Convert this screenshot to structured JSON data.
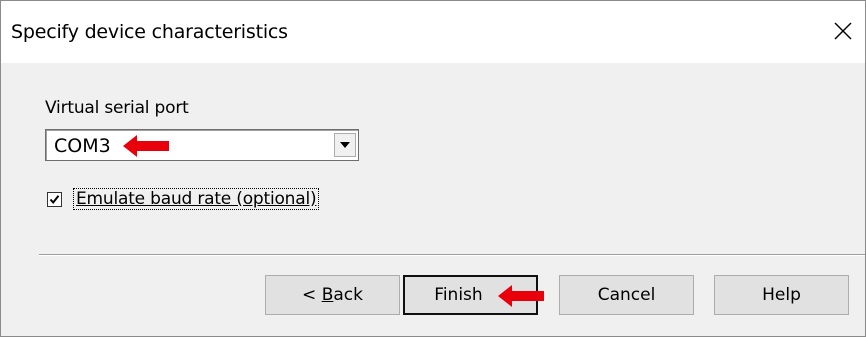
{
  "window": {
    "title": "Specify device characteristics",
    "close_glyph": "✕"
  },
  "port": {
    "label": "Virtual serial port",
    "selected": "COM3"
  },
  "baud": {
    "label": "Emulate baud rate (optional)",
    "checked": true
  },
  "buttons": {
    "back_prefix": "< ",
    "back_mnemonic": "B",
    "back_rest": "ack",
    "finish": "Finish",
    "cancel": "Cancel",
    "help": "Help"
  },
  "colors": {
    "annotation_arrow": "#e8000b",
    "dialog_bg": "#f0f0f0",
    "titlebar_bg": "#ffffff"
  },
  "icons": {
    "close": "close-icon",
    "dropdown": "chevron-down-icon",
    "check": "checkmark-icon",
    "annotation": "red-arrow-icon"
  }
}
